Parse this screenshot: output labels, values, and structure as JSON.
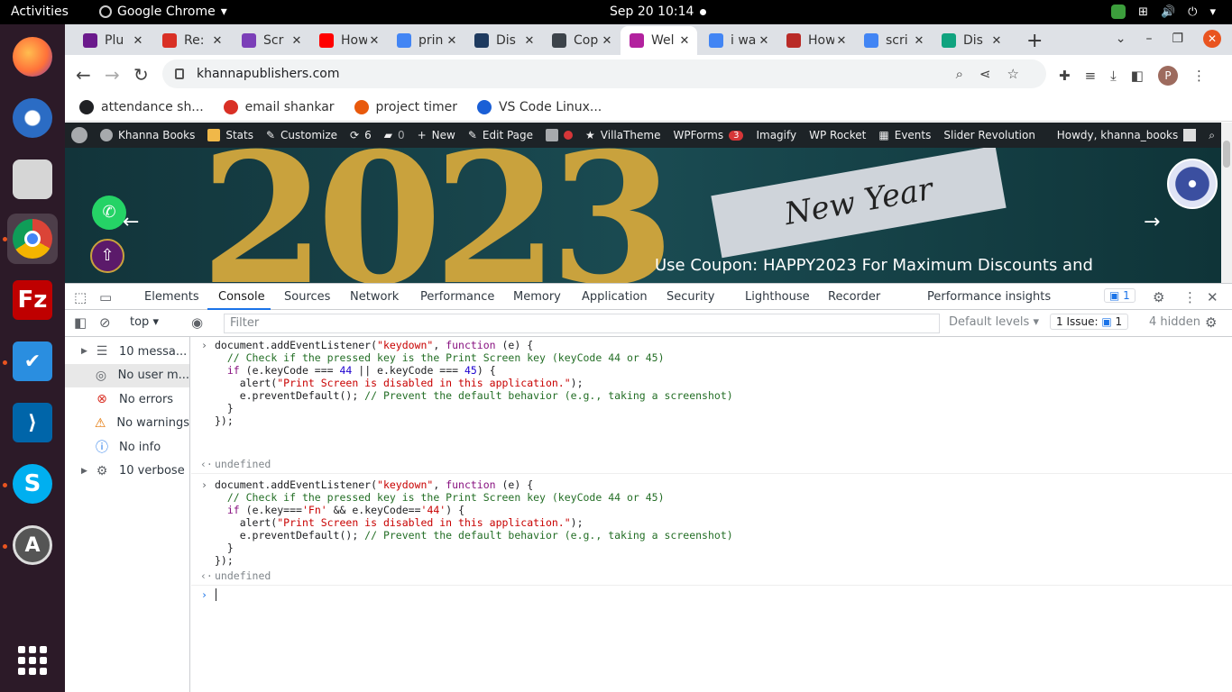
{
  "topbar": {
    "activities": "Activities",
    "app": "Google Chrome",
    "clock": "Sep 20  10:14"
  },
  "dock": {
    "items": [
      "Firefox",
      "Thunderbird",
      "Files",
      "Google Chrome",
      "FileZilla",
      "Task Tracker",
      "VS Code",
      "Skype",
      "Software Updater"
    ]
  },
  "tabs": [
    {
      "title": "Plu",
      "color": "#6b1a8c"
    },
    {
      "title": "Re:",
      "color": "#d93025"
    },
    {
      "title": "Scr",
      "color": "#7b3fb8"
    },
    {
      "title": "How",
      "color": "#ff0000"
    },
    {
      "title": "prin",
      "color": "#4285f4"
    },
    {
      "title": "Dis",
      "color": "#1e3a5f"
    },
    {
      "title": "Cop",
      "color": "#3c434a"
    },
    {
      "title": "Wel",
      "color": "#b2229e"
    },
    {
      "title": "i wa",
      "color": "#4285f4"
    },
    {
      "title": "How",
      "color": "#b92b27"
    },
    {
      "title": "scri",
      "color": "#4285f4"
    },
    {
      "title": "Dis",
      "color": "#10a37f"
    }
  ],
  "active_tab_index": 7,
  "address": "khannapublishers.com",
  "bookmarks": [
    {
      "label": "attendance sh...",
      "color": "#202124"
    },
    {
      "label": "email shankar",
      "color": "#d93025"
    },
    {
      "label": "project timer",
      "color": "#e8590c"
    },
    {
      "label": "VS Code Linux...",
      "color": "#1a5fd6"
    }
  ],
  "wpbar": {
    "site": "Khanna Books",
    "stats": "Stats",
    "customize": "Customize",
    "updates": "6",
    "comments": "0",
    "new": "New",
    "edit_page": "Edit Page",
    "villatheme": "VillaTheme",
    "wpforms": "WPForms",
    "wpforms_count": "3",
    "imagify": "Imagify",
    "wprocket": "WP Rocket",
    "events": "Events",
    "slider": "Slider Revolution",
    "howdy": "Howdy, khanna_books"
  },
  "banner": {
    "year": "2023",
    "ribbon": "New Year",
    "coupon": "Use Coupon: HAPPY2023 For Maximum Discounts and"
  },
  "devtools": {
    "tabs": [
      "Elements",
      "Console",
      "Sources",
      "Network",
      "Performance",
      "Memory",
      "Application",
      "Security",
      "Lighthouse",
      "Recorder",
      "Performance insights"
    ],
    "active_tab": "Console",
    "issues_badge": "1",
    "context": "top",
    "filter_placeholder": "Filter",
    "levels": "Default levels",
    "issues": "1 Issue:",
    "issues_count": "1",
    "hidden": "4 hidden",
    "sidebar": [
      {
        "label": "10 messa...",
        "icon": "list-icon",
        "expandable": true
      },
      {
        "label": "No user m...",
        "icon": "user-icon",
        "expandable": false
      },
      {
        "label": "No errors",
        "icon": "error-icon",
        "expandable": false
      },
      {
        "label": "No warnings",
        "icon": "warning-icon",
        "expandable": false
      },
      {
        "label": "No info",
        "icon": "info-icon",
        "expandable": false
      },
      {
        "label": "10 verbose",
        "icon": "bug-icon",
        "expandable": true
      }
    ],
    "entries": [
      {
        "result": "undefined"
      },
      {
        "result": "undefined"
      }
    ]
  }
}
